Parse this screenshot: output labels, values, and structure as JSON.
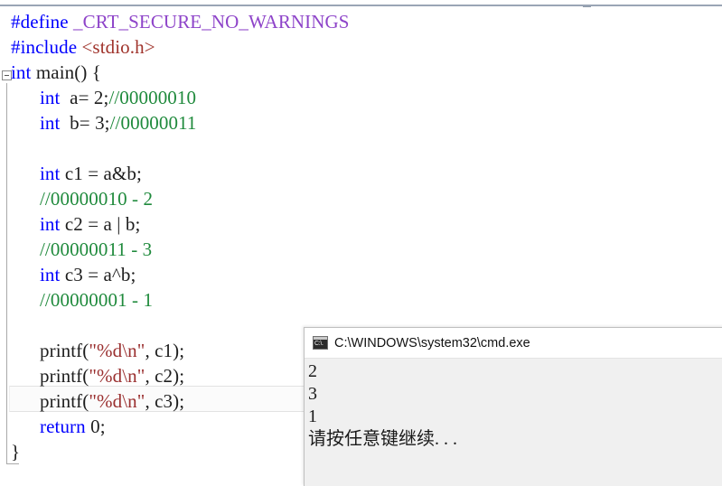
{
  "editor": {
    "name": "code-editor",
    "language": "C",
    "fold_marker": "-",
    "current_line_index": 14,
    "lines": [
      {
        "indent": 0,
        "tokens": [
          {
            "t": "#define",
            "c": "pre"
          },
          {
            "t": " ",
            "c": "plain"
          },
          {
            "t": "_CRT_SECURE_NO_WARNINGS",
            "c": "macro"
          }
        ]
      },
      {
        "indent": 0,
        "tokens": [
          {
            "t": "#include",
            "c": "pre"
          },
          {
            "t": " ",
            "c": "plain"
          },
          {
            "t": "<stdio.h>",
            "c": "hdr"
          }
        ]
      },
      {
        "indent": 0,
        "tokens": [
          {
            "t": "int",
            "c": "kw"
          },
          {
            "t": " main() {",
            "c": "plain"
          }
        ]
      },
      {
        "indent": 1,
        "tokens": [
          {
            "t": "int",
            "c": "kw"
          },
          {
            "t": "  a= 2;",
            "c": "plain"
          },
          {
            "t": "//00000010",
            "c": "cmt"
          }
        ]
      },
      {
        "indent": 1,
        "tokens": [
          {
            "t": "int",
            "c": "kw"
          },
          {
            "t": "  b= 3;",
            "c": "plain"
          },
          {
            "t": "//00000011",
            "c": "cmt"
          }
        ]
      },
      {
        "indent": 1,
        "tokens": []
      },
      {
        "indent": 1,
        "tokens": [
          {
            "t": "int",
            "c": "kw"
          },
          {
            "t": " c1 = a&b;",
            "c": "plain"
          }
        ]
      },
      {
        "indent": 1,
        "tokens": [
          {
            "t": "//00000010 - 2",
            "c": "cmt"
          }
        ]
      },
      {
        "indent": 1,
        "tokens": [
          {
            "t": "int",
            "c": "kw"
          },
          {
            "t": " c2 = a | b;",
            "c": "plain"
          }
        ]
      },
      {
        "indent": 1,
        "tokens": [
          {
            "t": "//00000011 - 3",
            "c": "cmt"
          }
        ]
      },
      {
        "indent": 1,
        "tokens": [
          {
            "t": "int",
            "c": "kw"
          },
          {
            "t": " c3 = a^b;",
            "c": "plain"
          }
        ]
      },
      {
        "indent": 1,
        "tokens": [
          {
            "t": "//00000001 - 1",
            "c": "cmt"
          }
        ]
      },
      {
        "indent": 1,
        "tokens": []
      },
      {
        "indent": 1,
        "tokens": [
          {
            "t": "printf(",
            "c": "plain"
          },
          {
            "t": "\"%d\\n\"",
            "c": "str"
          },
          {
            "t": ", c1);",
            "c": "plain"
          }
        ]
      },
      {
        "indent": 1,
        "tokens": [
          {
            "t": "printf(",
            "c": "plain"
          },
          {
            "t": "\"%d\\n\"",
            "c": "str"
          },
          {
            "t": ", c2);",
            "c": "plain"
          }
        ]
      },
      {
        "indent": 1,
        "tokens": [
          {
            "t": "printf(",
            "c": "plain"
          },
          {
            "t": "\"%d\\n\"",
            "c": "str"
          },
          {
            "t": ", c3);",
            "c": "plain"
          }
        ]
      },
      {
        "indent": 1,
        "tokens": [
          {
            "t": "return",
            "c": "kw"
          },
          {
            "t": " 0;",
            "c": "plain"
          }
        ]
      },
      {
        "indent": 0,
        "tokens": [
          {
            "t": "}",
            "c": "plain"
          }
        ]
      }
    ]
  },
  "console": {
    "title": "C:\\WINDOWS\\system32\\cmd.exe",
    "icon_glyph": "C:\\.",
    "output_lines": [
      "2",
      "3",
      "1",
      "请按任意键继续. . ."
    ]
  },
  "colors": {
    "keyword": "#0000ff",
    "preprocessor": "#0000ff",
    "macro_name": "#8e44c9",
    "header": "#a0342c",
    "comment": "#1f8a3c",
    "string": "#9a2f2f",
    "plain_text": "#1d1d1d",
    "editor_background": "#ffffff",
    "console_background": "#f0f0f0",
    "console_titlebar": "#ffffff",
    "current_line_highlight": "#fbfbfb",
    "rule": "#9aa5b5"
  }
}
